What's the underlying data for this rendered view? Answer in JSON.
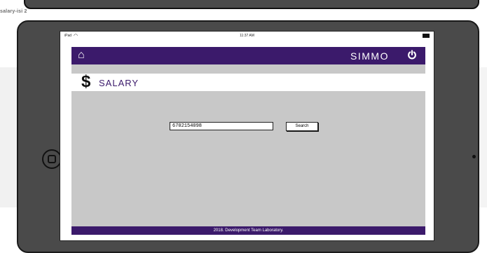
{
  "page": {
    "label": "salary-isi 2"
  },
  "device": {
    "status": {
      "carrier": "iPad",
      "time": "11:37 AM"
    }
  },
  "app": {
    "brand": "SIMMO",
    "section": {
      "title": "SALARY"
    },
    "search": {
      "value": "6702154098",
      "button": "Search"
    },
    "footer": "2018. Development Team Laboratory."
  },
  "colors": {
    "primary": "#3b1a6b",
    "panel": "#c8c8c8",
    "bezel": "#4a4a4a"
  },
  "icons": [
    "home-icon",
    "power-icon",
    "dollar-icon",
    "wifi-icon",
    "battery-icon"
  ]
}
